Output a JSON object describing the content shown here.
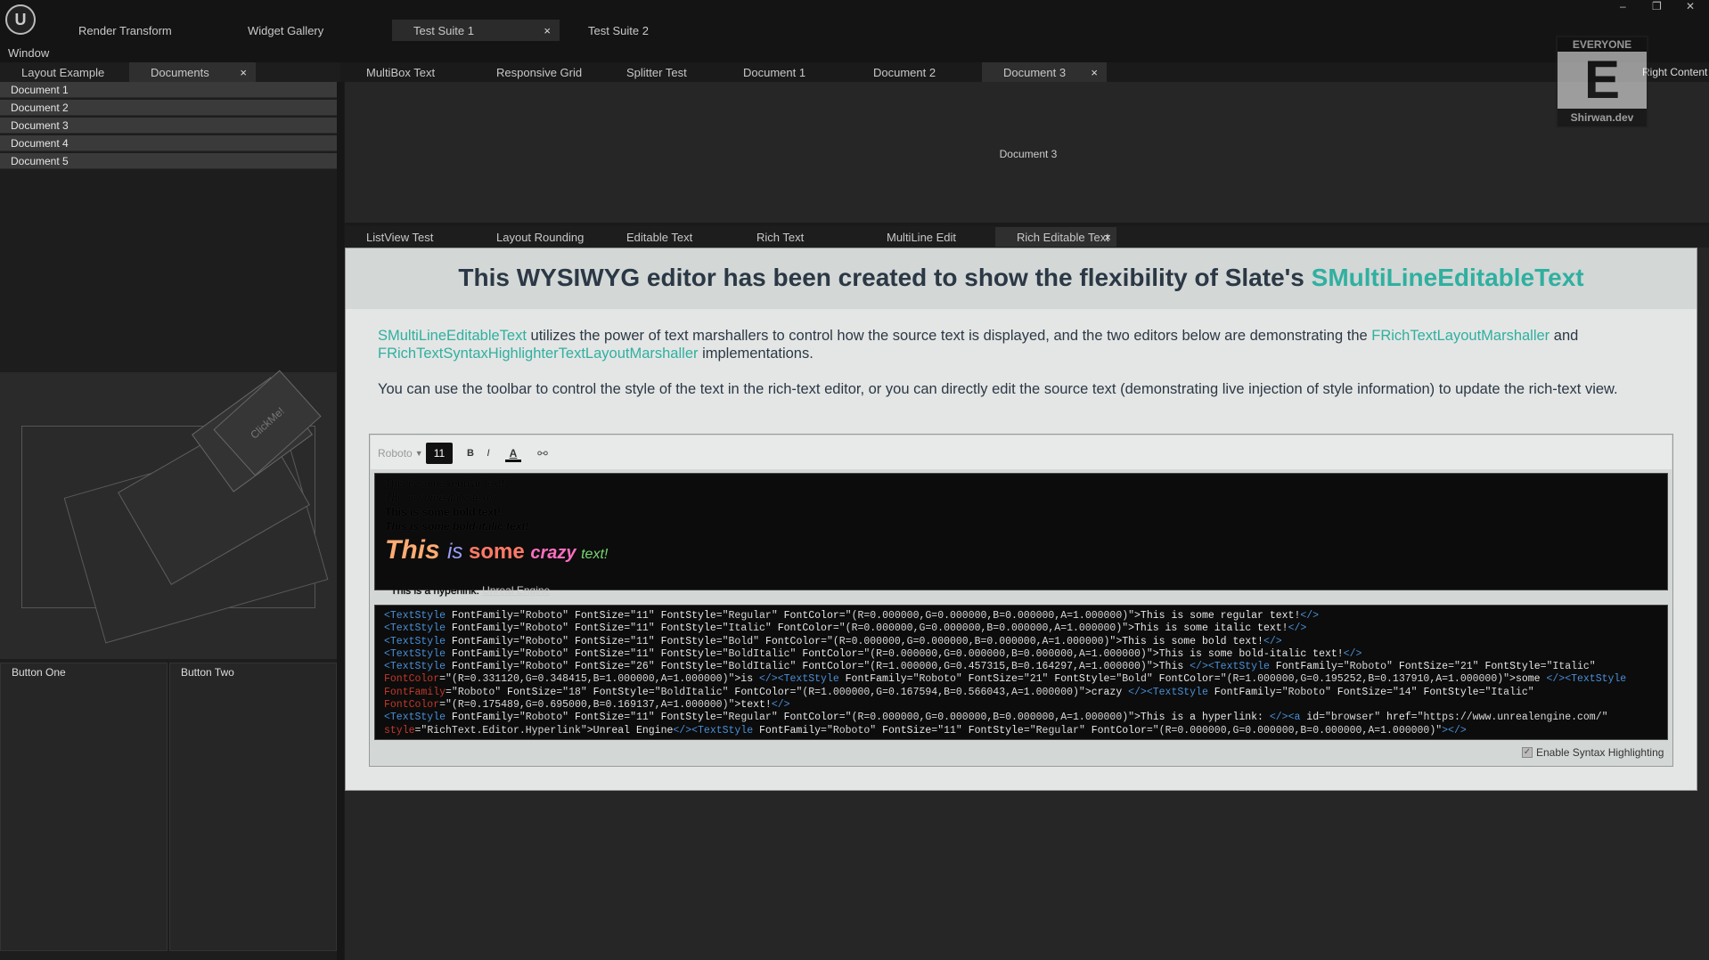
{
  "title_bar": {
    "window_menu": "Window",
    "tabs": [
      {
        "label": "Render Transform"
      },
      {
        "label": "Widget Gallery"
      },
      {
        "label": "Test Suite 1",
        "close": "×"
      },
      {
        "label": "Test Suite 2"
      }
    ],
    "controls": {
      "minimize": "–",
      "restore": "❐",
      "close": "✕"
    }
  },
  "left_panel": {
    "tabs": [
      {
        "label": "Layout Example"
      },
      {
        "label": "Documents",
        "close": "×"
      }
    ],
    "documents": [
      "Document 1",
      "Document 2",
      "Document 3",
      "Document 4",
      "Document 5"
    ],
    "rotated_button_label": "ClickMe!",
    "button_one": "Button One",
    "button_two": "Button Two"
  },
  "upper_tabs": [
    {
      "label": "MultiBox Text"
    },
    {
      "label": "Responsive Grid"
    },
    {
      "label": "Splitter Test"
    },
    {
      "label": "Document 1"
    },
    {
      "label": "Document 2"
    },
    {
      "label": "Document 3",
      "close": "×"
    }
  ],
  "upper_content": "Document 3",
  "badge": {
    "rating": "EVERYONE",
    "letter": "E",
    "site": "Shirwan.dev"
  },
  "right_content_label": "Right Content",
  "lower_tabs": [
    {
      "label": "ListView Test"
    },
    {
      "label": "Layout Rounding"
    },
    {
      "label": "Editable Text"
    },
    {
      "label": "Rich Text"
    },
    {
      "label": "MultiLine Edit"
    },
    {
      "label": "Rich Editable Text",
      "close": "×"
    }
  ],
  "editor": {
    "heading_prefix": "This WYSIWYG editor has been created to show the flexibility of Slate's",
    "heading_link": "SMultiLineEditableText",
    "para1": {
      "link1": "SMultiLineEditableText",
      "text1": " utilizes the power of text marshallers to control how the source text is displayed, and the two editors below are demonstrating the ",
      "link2": "FRichTextLayoutMarshaller",
      "text2": " and",
      "link3": "FRichTextSyntaxHighlighterTextLayoutMarshaller",
      "text3": " implementations."
    },
    "para2": "You can use the toolbar to control the style of the text in the rich-text editor, or you can directly edit the source text (demonstrating live injection of style information) to update the rich-text view.",
    "toolbar": {
      "font": "Roboto",
      "size": "11",
      "bold": "B",
      "italic": "I",
      "color": "A"
    },
    "rich": {
      "line1": "This is some regular text!",
      "line2": "This is some italic text!",
      "line3": "This is some bold text!",
      "line4": "This is some bold-italic text!",
      "crazy": [
        "This ",
        "is ",
        "some ",
        "crazy ",
        "text!"
      ],
      "hyperlink_prefix": "This is a hyperlink: ",
      "hyperlink": "Unreal Engine"
    },
    "source_lines": [
      "<TextStyle FontFamily=\"Roboto\" FontSize=\"11\" FontStyle=\"Regular\" FontColor=\"(R=0.000000,G=0.000000,B=0.000000,A=1.000000)\">This is some regular text!</>",
      "<TextStyle FontFamily=\"Roboto\" FontSize=\"11\" FontStyle=\"Italic\" FontColor=\"(R=0.000000,G=0.000000,B=0.000000,A=1.000000)\">This is some italic text!</>",
      "<TextStyle FontFamily=\"Roboto\" FontSize=\"11\" FontStyle=\"Bold\" FontColor=\"(R=0.000000,G=0.000000,B=0.000000,A=1.000000)\">This is some bold text!</>",
      "<TextStyle FontFamily=\"Roboto\" FontSize=\"11\" FontStyle=\"BoldItalic\" FontColor=\"(R=0.000000,G=0.000000,B=0.000000,A=1.000000)\">This is some bold-italic text!</>",
      "<TextStyle FontFamily=\"Roboto\" FontSize=\"26\" FontStyle=\"BoldItalic\" FontColor=\"(R=1.000000,G=0.457315,B=0.164297,A=1.000000)\">This </><TextStyle FontFamily=\"Roboto\" FontSize=\"21\" FontStyle=\"Italic\"",
      "FontColor=\"(R=0.331120,G=0.348415,B=1.000000,A=1.000000)\">is </><TextStyle FontFamily=\"Roboto\" FontSize=\"21\" FontStyle=\"Bold\" FontColor=\"(R=1.000000,G=0.195252,B=0.137910,A=1.000000)\">some </><TextStyle",
      "FontFamily=\"Roboto\" FontSize=\"18\" FontStyle=\"BoldItalic\" FontColor=\"(R=1.000000,G=0.167594,B=0.566043,A=1.000000)\">crazy </><TextStyle FontFamily=\"Roboto\" FontSize=\"14\" FontStyle=\"Italic\"",
      "FontColor=\"(R=0.175489,G=0.695000,B=0.169137,A=1.000000)\">text!</>",
      "<TextStyle FontFamily=\"Roboto\" FontSize=\"11\" FontStyle=\"Regular\" FontColor=\"(R=0.000000,G=0.000000,B=0.000000,A=1.000000)\">This is a hyperlink: </><a id=\"browser\" href=\"https://www.unrealengine.com/\"",
      "style=\"RichText.Editor.Hyperlink\">Unreal Engine</><TextStyle FontFamily=\"Roboto\" FontSize=\"11\" FontStyle=\"Regular\" FontColor=\"(R=0.000000,G=0.000000,B=0.000000,A=1.000000)\"></>"
    ],
    "syntax_checkbox_label": "Enable Syntax Highlighting",
    "syntax_checked": true
  },
  "colors": {
    "accent_teal": "#2fb0a0",
    "crazy_this": "#ffab73",
    "crazy_is": "#9aa0ff",
    "crazy_some": "#ff7a66",
    "crazy_crazy": "#ff6fc0",
    "crazy_text": "#78d674"
  }
}
